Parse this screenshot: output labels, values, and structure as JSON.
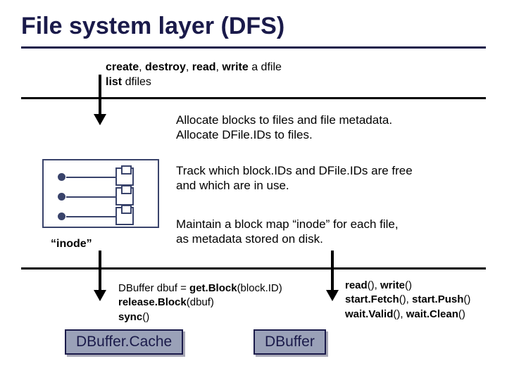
{
  "title": "File system layer (DFS)",
  "ops": {
    "line1_prefix": "create",
    "line1_sep1": ", ",
    "line1_destroy": "destroy",
    "line1_sep2": ", ",
    "line1_read": "read",
    "line1_sep3": ", ",
    "line1_write": "write",
    "line1_suffix": " a dfile",
    "line2_prefix": "list",
    "line2_suffix": " dfiles"
  },
  "body": {
    "p1_l1": "Allocate blocks to files and file metadata.",
    "p1_l2": "Allocate DFile.IDs to files.",
    "p2_l1": "Track which block.IDs and DFile.IDs are free",
    "p2_l2": "and which are in use.",
    "p3_l1": "Maintain a block map “inode” for each file,",
    "p3_l2": "as metadata stored on disk."
  },
  "inode_label": "“inode”",
  "api_left": {
    "l1_pre": "DBuffer dbuf = ",
    "l1_b": "get.Block",
    "l1_post": "(block.ID)",
    "l2_b": "release.Block",
    "l2_post": "(dbuf)",
    "l3_b": "sync",
    "l3_post": "()"
  },
  "api_right": {
    "l1_a": "read",
    "l1_mid": "(), ",
    "l1_b": "write",
    "l1_end": "()",
    "l2_a": "start.Fetch",
    "l2_mid": "(), ",
    "l2_b": "start.Push",
    "l2_end": "()",
    "l3_a": "wait.Valid",
    "l3_mid": "(), ",
    "l3_b": "wait.Clean",
    "l3_end": "()"
  },
  "badges": {
    "cache": "DBuffer.Cache",
    "dbuffer": "DBuffer"
  }
}
